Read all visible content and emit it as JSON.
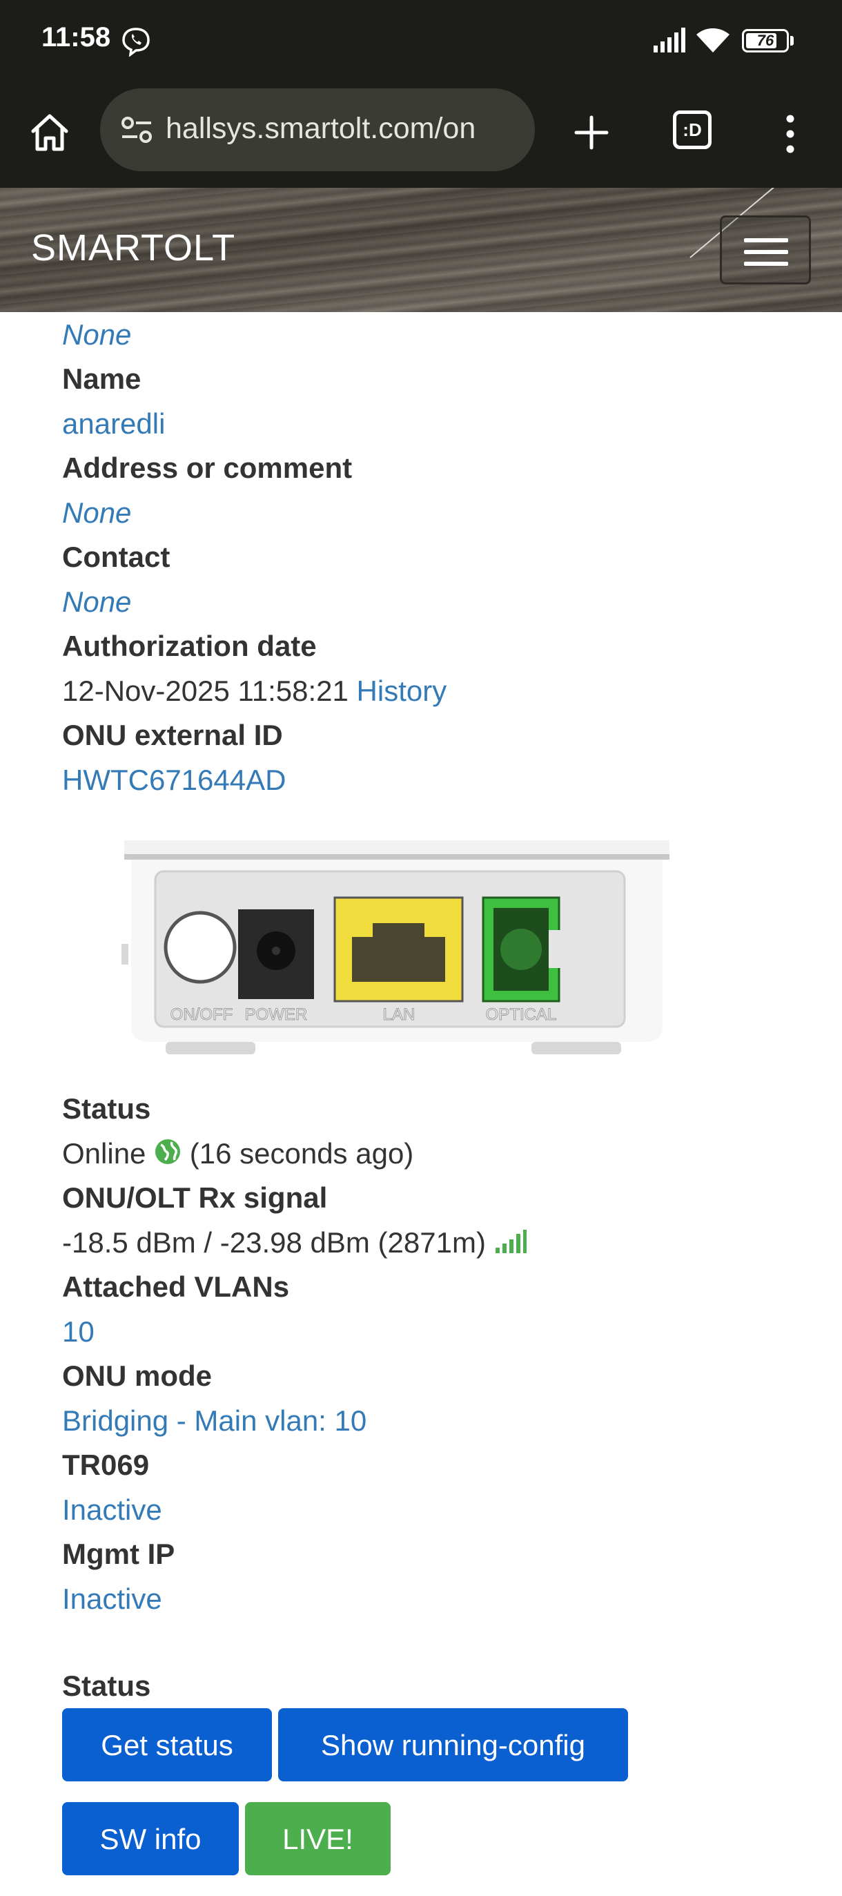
{
  "status_bar": {
    "time": "11:58",
    "battery": "76",
    "icons": [
      "viber-icon",
      "signal-icon",
      "wifi-icon",
      "battery-icon"
    ]
  },
  "browser": {
    "url": "hallsys.smartolt.com/on",
    "tab_count_label": ":D",
    "icons": [
      "home-icon",
      "site-settings-icon",
      "new-tab-icon",
      "tabs-icon",
      "more-menu-icon"
    ]
  },
  "header": {
    "brand": "SMARTOLT",
    "menu_icon": "hamburger-icon"
  },
  "details": {
    "top_value": "None",
    "name_label": "Name",
    "name_value": "anaredli",
    "address_label": "Address or comment",
    "address_value": "None",
    "contact_label": "Contact",
    "contact_value": "None",
    "auth_date_label": "Authorization date",
    "auth_date_value": "12-Nov-2025 11:58:21",
    "history_link": "History",
    "external_id_label": "ONU external ID",
    "external_id_value": "HWTC671644AD"
  },
  "device_image": {
    "ports": [
      "ON/OFF",
      "POWER",
      "LAN",
      "OPTICAL"
    ],
    "colors": {
      "lan": "#f0dc3c",
      "optical": "#3fbf3f"
    }
  },
  "status_info": {
    "status_label": "Status",
    "status_value": "Online",
    "status_ago": "(16 seconds ago)",
    "status_icon": "globe-online-icon",
    "signal_label": "ONU/OLT Rx signal",
    "signal_value": "-18.5 dBm / -23.98 dBm (2871m)",
    "signal_icon": "signal-strength-icon",
    "vlans_label": "Attached VLANs",
    "vlans_value": "10",
    "mode_label": "ONU mode",
    "mode_value": "Bridging - Main vlan: 10",
    "tr069_label": "TR069",
    "tr069_value": "Inactive",
    "mgmt_label": "Mgmt IP",
    "mgmt_value": "Inactive"
  },
  "actions": {
    "section_label": "Status",
    "get_status": "Get status",
    "show_running_config": "Show running-config",
    "sw_info": "SW info",
    "live": "LIVE!"
  },
  "colors": {
    "link": "#337ab7",
    "label": "#333333",
    "button_blue": "#0a5fd1",
    "button_green": "#4cae4c",
    "online_green": "#4cae4c"
  }
}
